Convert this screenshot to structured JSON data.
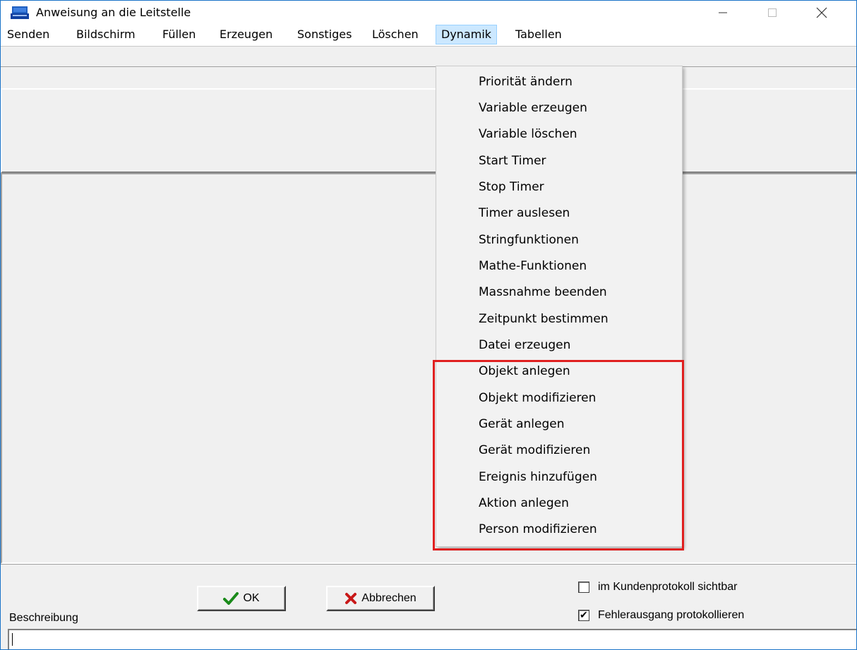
{
  "window": {
    "title": "Anweisung an die Leitstelle",
    "accent_color": "#1a73c8"
  },
  "menu": {
    "items": [
      {
        "label": "Senden"
      },
      {
        "label": "Bildschirm"
      },
      {
        "label": "Füllen"
      },
      {
        "label": "Erzeugen"
      },
      {
        "label": "Sonstiges"
      },
      {
        "label": "Löschen"
      },
      {
        "label": "Dynamik",
        "active": true
      },
      {
        "label": "Tabellen"
      }
    ]
  },
  "dropdown": {
    "items": [
      {
        "label": "Priorität ändern"
      },
      {
        "label": "Variable erzeugen"
      },
      {
        "label": "Variable löschen"
      },
      {
        "label": "Start Timer"
      },
      {
        "label": "Stop Timer"
      },
      {
        "label": "Timer auslesen"
      },
      {
        "label": "Stringfunktionen"
      },
      {
        "label": "Mathe-Funktionen"
      },
      {
        "label": "Massnahme beenden"
      },
      {
        "label": "Zeitpunkt bestimmen"
      },
      {
        "label": "Datei erzeugen"
      },
      {
        "label": "Objekt anlegen",
        "highlighted": true
      },
      {
        "label": "Objekt modifizieren",
        "highlighted": true
      },
      {
        "label": "Gerät anlegen",
        "highlighted": true
      },
      {
        "label": "Gerät modifizieren",
        "highlighted": true
      },
      {
        "label": "Ereignis hinzufügen",
        "highlighted": true
      },
      {
        "label": "Aktion anlegen",
        "highlighted": true
      },
      {
        "label": "Person modifizieren",
        "highlighted": true
      }
    ],
    "highlight_color": "#e02020"
  },
  "buttons": {
    "ok_label": "OK",
    "ok_icon": "checkmark-icon",
    "cancel_label": "Abbrechen",
    "cancel_icon": "x-mark-icon"
  },
  "options": {
    "customer_log_visible": {
      "label": "im Kundenprotokoll sichtbar",
      "checked": false
    },
    "log_error_exit": {
      "label": "Fehlerausgang protokollieren",
      "checked": true
    }
  },
  "description": {
    "label": "Beschreibung",
    "value": ""
  }
}
